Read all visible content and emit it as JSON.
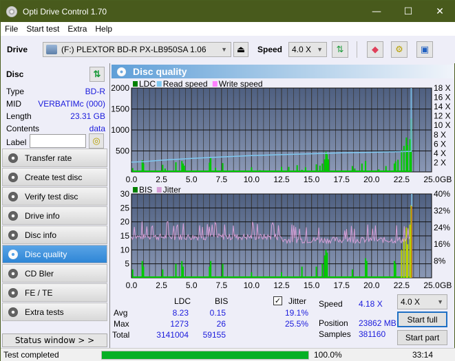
{
  "window": {
    "title": "Opti Drive Control 1.70",
    "minimize": "—",
    "maximize": "☐",
    "close": "✕"
  },
  "menu": [
    "File",
    "Start test",
    "Extra",
    "Help"
  ],
  "toolbar": {
    "drive_label": "Drive",
    "drive_value": "(F:)  PLEXTOR BD-R  PX-LB950SA 1.06",
    "speed_label": "Speed",
    "speed_value": "4.0 X"
  },
  "disc": {
    "header": "Disc",
    "fields": [
      {
        "label": "Type",
        "value": "BD-R"
      },
      {
        "label": "MID",
        "value": "VERBATIMc (000)"
      },
      {
        "label": "Length",
        "value": "23.31 GB"
      },
      {
        "label": "Contents",
        "value": "data"
      }
    ],
    "label_field": {
      "label": "Label",
      "value": ""
    }
  },
  "nav": [
    {
      "label": "Transfer rate",
      "active": false
    },
    {
      "label": "Create test disc",
      "active": false
    },
    {
      "label": "Verify test disc",
      "active": false
    },
    {
      "label": "Drive info",
      "active": false
    },
    {
      "label": "Disc info",
      "active": false
    },
    {
      "label": "Disc quality",
      "active": true
    },
    {
      "label": "CD Bler",
      "active": false
    },
    {
      "label": "FE / TE",
      "active": false
    },
    {
      "label": "Extra tests",
      "active": false
    }
  ],
  "status_window_label": "Status window > >",
  "panel_title": "Disc quality",
  "chart_data": [
    {
      "type": "bar",
      "title": "LDC",
      "legend": [
        "LDC",
        "Read speed",
        "Write speed"
      ],
      "legend_colors": [
        "#008000",
        "#7ec8f0",
        "#ff80ff"
      ],
      "xlabel": "GB",
      "x_ticks": [
        "0.0",
        "2.5",
        "5.0",
        "7.5",
        "10.0",
        "12.5",
        "15.0",
        "17.5",
        "20.0",
        "22.5",
        "25.0"
      ],
      "xlim": [
        0,
        25
      ],
      "ylim": [
        0,
        2000
      ],
      "y_ticks": [
        500,
        1000,
        1500,
        2000
      ],
      "y2_ticks": [
        "2 X",
        "4 X",
        "6 X",
        "8 X",
        "10 X",
        "12 X",
        "14 X",
        "16 X",
        "18 X"
      ],
      "y2lim": [
        0,
        18
      ],
      "ldc_spikes": [
        [
          0.1,
          90
        ],
        [
          0.9,
          280
        ],
        [
          1.0,
          200
        ],
        [
          2.6,
          170
        ],
        [
          2.8,
          80
        ],
        [
          3.7,
          230
        ],
        [
          4.2,
          260
        ],
        [
          4.3,
          200
        ],
        [
          4.4,
          150
        ],
        [
          6.5,
          220
        ],
        [
          6.6,
          330
        ],
        [
          7.0,
          100
        ],
        [
          7.6,
          210
        ],
        [
          8.5,
          40
        ],
        [
          10.0,
          110
        ],
        [
          10.7,
          40
        ],
        [
          12.5,
          120
        ],
        [
          13.1,
          120
        ],
        [
          13.8,
          160
        ],
        [
          14.2,
          50
        ],
        [
          14.5,
          110
        ],
        [
          15.4,
          180
        ],
        [
          15.7,
          150
        ],
        [
          15.9,
          200
        ],
        [
          16.1,
          300
        ],
        [
          16.2,
          480
        ],
        [
          16.3,
          420
        ],
        [
          16.4,
          300
        ],
        [
          17.1,
          30
        ],
        [
          18.4,
          140
        ],
        [
          18.6,
          80
        ],
        [
          19.2,
          200
        ],
        [
          19.5,
          260
        ],
        [
          20.6,
          60
        ],
        [
          21.2,
          140
        ],
        [
          21.9,
          200
        ],
        [
          22.0,
          250
        ],
        [
          22.2,
          290
        ],
        [
          22.5,
          520
        ],
        [
          22.7,
          620
        ],
        [
          22.9,
          820
        ],
        [
          23.0,
          640
        ],
        [
          23.2,
          780
        ],
        [
          23.3,
          1273
        ]
      ],
      "read_speed": [
        [
          0.0,
          2.1
        ],
        [
          1.0,
          2.2
        ],
        [
          2.5,
          2.5
        ],
        [
          5.0,
          2.9
        ],
        [
          7.5,
          3.2
        ],
        [
          10.0,
          3.5
        ],
        [
          12.5,
          3.7
        ],
        [
          15.0,
          3.9
        ],
        [
          17.5,
          4.1
        ],
        [
          20.0,
          4.2
        ],
        [
          23.3,
          4.4
        ],
        [
          23.3,
          18
        ]
      ]
    },
    {
      "type": "bar",
      "title": "BIS",
      "legend": [
        "BIS",
        "Jitter"
      ],
      "legend_colors": [
        "#008000",
        "#d8a0d8"
      ],
      "xlabel": "GB",
      "x_ticks": [
        "0.0",
        "2.5",
        "5.0",
        "7.5",
        "10.0",
        "12.5",
        "15.0",
        "17.5",
        "20.0",
        "22.5",
        "25.0"
      ],
      "xlim": [
        0,
        25
      ],
      "ylim": [
        0,
        30
      ],
      "y_ticks": [
        5,
        10,
        15,
        20,
        25,
        30
      ],
      "y2_ticks": [
        "8%",
        "16%",
        "24%",
        "32%",
        "40%"
      ],
      "y2lim": [
        0,
        40
      ],
      "bis_spikes": [
        [
          0.1,
          3
        ],
        [
          0.9,
          6
        ],
        [
          1.0,
          4
        ],
        [
          2.6,
          3
        ],
        [
          3.7,
          5
        ],
        [
          4.2,
          6
        ],
        [
          4.3,
          4
        ],
        [
          6.5,
          4
        ],
        [
          6.6,
          6
        ],
        [
          7.6,
          5
        ],
        [
          10.0,
          2
        ],
        [
          12.5,
          2
        ],
        [
          14.2,
          4
        ],
        [
          15.4,
          4
        ],
        [
          15.9,
          5
        ],
        [
          16.1,
          8
        ],
        [
          16.2,
          10
        ],
        [
          16.3,
          9
        ],
        [
          18.4,
          3
        ],
        [
          19.5,
          7
        ],
        [
          19.6,
          6
        ],
        [
          21.9,
          6
        ],
        [
          22.0,
          5
        ],
        [
          22.5,
          10
        ],
        [
          22.7,
          14
        ],
        [
          22.9,
          18
        ],
        [
          23.0,
          12
        ],
        [
          23.2,
          19
        ],
        [
          23.3,
          26
        ]
      ],
      "jitter_pct": {
        "baseline": 18.5,
        "max": 25.5,
        "avg": 19.1
      }
    }
  ],
  "stats": {
    "headers": [
      "LDC",
      "BIS"
    ],
    "rows": [
      {
        "label": "Avg",
        "ldc": "8.23",
        "bis": "0.15",
        "jitter": "19.1%"
      },
      {
        "label": "Max",
        "ldc": "1273",
        "bis": "26",
        "jitter": "25.5%"
      },
      {
        "label": "Total",
        "ldc": "3141004",
        "bis": "59155"
      }
    ],
    "jitter_label": "Jitter",
    "jitter_checked": true,
    "speed_label": "Speed",
    "speed_value": "4.18 X",
    "position_label": "Position",
    "position_value": "23862 MB",
    "samples_label": "Samples",
    "samples_value": "381160",
    "speed_select": "4.0 X",
    "start_full": "Start full",
    "start_part": "Start part"
  },
  "statusbar": {
    "text": "Test completed",
    "progress": 100.0,
    "progress_text": "100.0%",
    "time": "33:14"
  }
}
